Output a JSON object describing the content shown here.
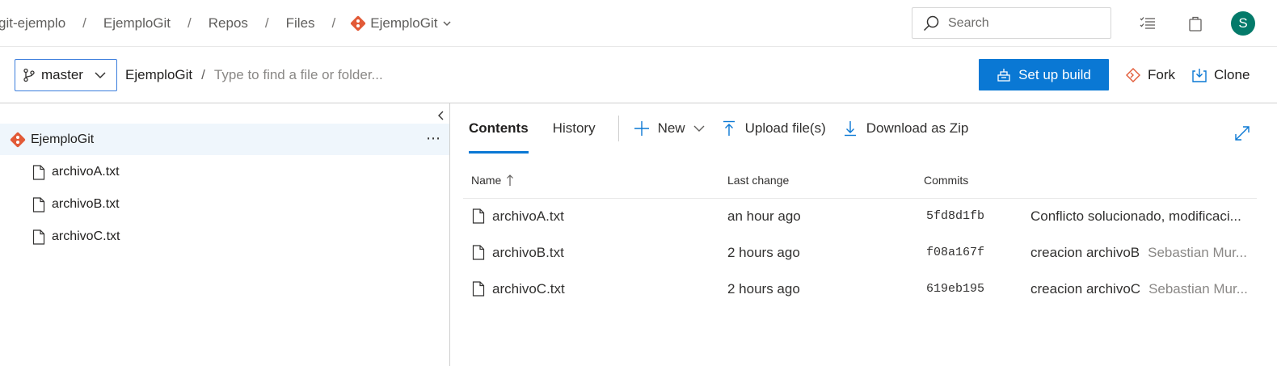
{
  "breadcrumb": {
    "items": [
      "git-ejemplo",
      "EjemploGit",
      "Repos",
      "Files"
    ],
    "repo": "EjemploGit"
  },
  "search": {
    "placeholder": "Search"
  },
  "user": {
    "initial": "S",
    "avatar_color": "#047a6a"
  },
  "branch": {
    "name": "master"
  },
  "path": {
    "root": "EjemploGit",
    "separator": "/",
    "placeholder": "Type to find a file or folder..."
  },
  "actions": {
    "setup_build": "Set up build",
    "fork": "Fork",
    "clone": "Clone"
  },
  "tree": {
    "root": "EjemploGit",
    "more": "⋯",
    "files": [
      "archivoA.txt",
      "archivoB.txt",
      "archivoC.txt"
    ]
  },
  "tabs": {
    "contents": "Contents",
    "history": "History"
  },
  "toolbar": {
    "new": "New",
    "upload": "Upload file(s)",
    "download": "Download as Zip"
  },
  "table": {
    "headers": {
      "name": "Name",
      "last_change": "Last change",
      "commits": "Commits"
    },
    "rows": [
      {
        "name": "archivoA.txt",
        "last_change": "an hour ago",
        "commit": "5fd8d1fb",
        "message": "Conflicto solucionado, modificaci...",
        "author": ""
      },
      {
        "name": "archivoB.txt",
        "last_change": "2 hours ago",
        "commit": "f08a167f",
        "message": "creacion archivoB",
        "author": "Sebastian Mur..."
      },
      {
        "name": "archivoC.txt",
        "last_change": "2 hours ago",
        "commit": "619eb195",
        "message": "creacion archivoC",
        "author": "Sebastian Mur..."
      }
    ]
  },
  "colors": {
    "accent": "#0a78d4",
    "git_logo": "#e25a37",
    "selected_row": "#eff6fc"
  }
}
